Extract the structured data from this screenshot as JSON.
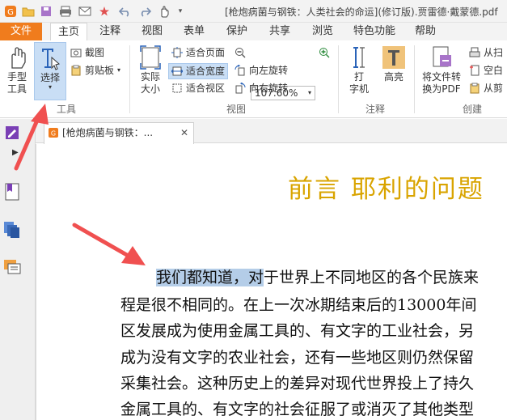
{
  "window": {
    "title": "[枪炮病菌与钢铁：人类社会的命运](修订版).贾雷德·戴蒙德.pdf"
  },
  "menu": {
    "tabs": [
      "文件",
      "主页",
      "注释",
      "视图",
      "表单",
      "保护",
      "共享",
      "浏览",
      "特色功能",
      "帮助"
    ],
    "active_tab": "主页"
  },
  "ribbon": {
    "tools_group": {
      "label": "工具",
      "hand_label": "手型\n工具",
      "select_label": "选择",
      "screenshot_label": "截图",
      "clipboard_label": "剪贴板"
    },
    "view_group": {
      "label": "视图",
      "actual_size_label": "实际\n大小",
      "fit_page": "适合页面",
      "fit_width": "适合宽度",
      "fit_visible": "适合视区",
      "zoom_value": "107.60%",
      "rotate_left": "向左旋转",
      "rotate_right": "向右旋转"
    },
    "annot_group": {
      "label": "注释",
      "typewriter_label": "打\n字机",
      "highlight_label": "高亮"
    },
    "create_group": {
      "label": "创建",
      "convert_label": "将文件转\n换为PDF",
      "from_scanner": "从扫",
      "blank": "空白",
      "from_clipboard": "从剪"
    }
  },
  "document": {
    "tab_title": "[枪炮病菌与钢铁：...",
    "heading": "前言  耶利的问题",
    "lines": [
      {
        "highlight": "我们都知道，对",
        "rest": "于世界上不同地区的各个民族来"
      },
      {
        "text": "程是很不相同的。在上一次冰期结束后的13000年间"
      },
      {
        "text": "区发展成为使用金属工具的、有文字的工业社会，另"
      },
      {
        "text": "成为没有文字的农业社会，还有一些地区则仍然保留"
      },
      {
        "text": "采集社会。这种历史上的差异对现代世界投上了持久"
      },
      {
        "text": "金属工具的、有文字的社会征服了或消灭了其他类型"
      }
    ]
  },
  "colors": {
    "accent_orange": "#f07c1d",
    "heading_gold": "#d9a400",
    "highlight_blue": "#b4cde8",
    "arrow_red": "#f05050"
  }
}
